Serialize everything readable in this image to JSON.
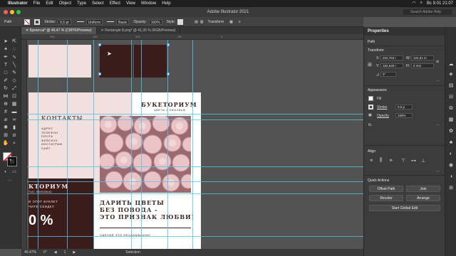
{
  "menubar": {
    "app": "Illustrator",
    "items": [
      "File",
      "Edit",
      "Object",
      "Type",
      "Select",
      "Effect",
      "View",
      "Window",
      "Help"
    ],
    "clock": "Вс 9.01  21:07"
  },
  "titlebar": {
    "title": "Adobe Illustrator 2021",
    "search_placeholder": "Search Adobe Help"
  },
  "controlbar": {
    "selection": "Path",
    "stroke_label": "Stroke:",
    "stroke_value": "0,5 pt",
    "uniform": "Uniform",
    "basic": "Basic",
    "opacity_label": "Opacity:",
    "opacity_value": "100%",
    "style_label": "Style:",
    "transform_label": "Transform"
  },
  "tabs": [
    {
      "label": "Буклет.ai* @ 46,47 % (CMYK/Preview)",
      "active": true
    },
    {
      "label": "Rectangle 8.png* @ 41,35 % (RGB/Preview)",
      "active": false
    }
  ],
  "rulers": {
    "h": [
      "200",
      "150",
      "100",
      "50",
      "0"
    ]
  },
  "statusbar": {
    "zoom": "46,47%",
    "angle": "0°",
    "page": "1",
    "mode": "Selection"
  },
  "panel": {
    "title": "Properties",
    "object": "Path",
    "transform": {
      "title": "Transform",
      "x_label": "X:",
      "x": "222,753 r",
      "y_label": "Y:",
      "y": "184,549 r",
      "w_label": "W:",
      "w": "124,51 m",
      "h_label": "H:",
      "h": "0 mm",
      "angle": "0°"
    },
    "appearance": {
      "title": "Appearance",
      "fill_label": "Fill",
      "stroke_label": "Stroke",
      "stroke_value": "0,5 p",
      "opacity_label": "Opacity",
      "opacity_value": "100%",
      "fx": "fx."
    },
    "align": {
      "title": "Align"
    },
    "quick_actions": {
      "title": "Quick Actions",
      "offset_path": "Offset Path",
      "join": "Join",
      "recolor": "Recolor",
      "arrange": "Arrange",
      "global_edit": "Start Global Edit"
    }
  },
  "artboard": {
    "contacts_title": "КОНТАКТЫ",
    "contacts_lines": [
      "АДРЕС",
      "ТЕЛЕФОН",
      "ПОЧТА",
      "ФЕЙСБУК",
      "ИНСТАГРАМ",
      "САЙТ"
    ],
    "brand": "БУКЕТОРИУМ",
    "brand_sub": "ЦВЕТЫ С ЛЮБОВЬЮ",
    "left_brand": "КТОРИУМ",
    "left_brand_sub": "ТЫС ЛЮБОВЬЮ",
    "left_promo_1": "И ЭТОТ БУКЛЕТ",
    "left_promo_2": "ЧИТЕ СКИДКУ",
    "left_percent": "0 %",
    "headline_1": "ДАРИТЬ ЦВЕТЫ",
    "headline_2": "БЕЗ ПОВОДА -",
    "headline_3": "ЭТО ПРИЗНАК ЛЮБВИ!",
    "footer": "СДЕЛАЙ ЭТО НЕЗАБЫВАЕМО"
  },
  "colors": {
    "dark_brown": "#3a1d1a",
    "pink": "#f2e0df",
    "guide": "#4fc3e8",
    "accent_button": "#1473e6"
  }
}
